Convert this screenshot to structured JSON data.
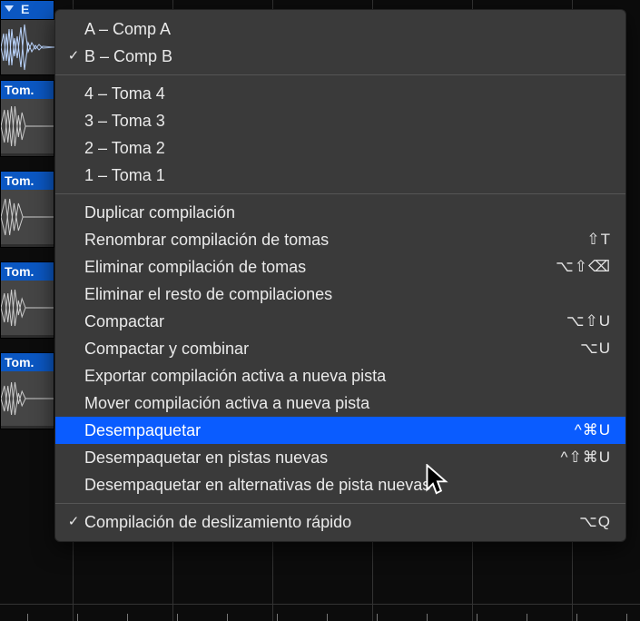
{
  "topbar_letter": "E",
  "takes": [
    {
      "label": "Tom."
    },
    {
      "label": "Tom."
    },
    {
      "label": "Tom."
    },
    {
      "label": "Tom."
    }
  ],
  "menu": {
    "section1": [
      {
        "checked": false,
        "label": "A – Comp A",
        "shortcut": ""
      },
      {
        "checked": true,
        "label": "B – Comp B",
        "shortcut": ""
      }
    ],
    "section2": [
      {
        "checked": false,
        "label": "4 – Toma 4",
        "shortcut": ""
      },
      {
        "checked": false,
        "label": "3 – Toma 3",
        "shortcut": ""
      },
      {
        "checked": false,
        "label": "2 – Toma 2",
        "shortcut": ""
      },
      {
        "checked": false,
        "label": "1 – Toma 1",
        "shortcut": ""
      }
    ],
    "section3": [
      {
        "checked": false,
        "label": "Duplicar compilación",
        "shortcut": "",
        "hl": false
      },
      {
        "checked": false,
        "label": "Renombrar compilación de tomas",
        "shortcut": "⇧T",
        "hl": false
      },
      {
        "checked": false,
        "label": "Eliminar compilación de tomas",
        "shortcut": "⌥⇧⌫",
        "hl": false
      },
      {
        "checked": false,
        "label": "Eliminar el resto de compilaciones",
        "shortcut": "",
        "hl": false
      },
      {
        "checked": false,
        "label": "Compactar",
        "shortcut": "⌥⇧U",
        "hl": false
      },
      {
        "checked": false,
        "label": "Compactar y combinar",
        "shortcut": "⌥U",
        "hl": false
      },
      {
        "checked": false,
        "label": "Exportar compilación activa a nueva pista",
        "shortcut": "",
        "hl": false
      },
      {
        "checked": false,
        "label": "Mover compilación activa a nueva pista",
        "shortcut": "",
        "hl": false
      },
      {
        "checked": false,
        "label": "Desempaquetar",
        "shortcut": "^⌘U",
        "hl": true
      },
      {
        "checked": false,
        "label": "Desempaquetar en pistas nuevas",
        "shortcut": "^⇧⌘U",
        "hl": false
      },
      {
        "checked": false,
        "label": "Desempaquetar en alternativas de pista nuevas",
        "shortcut": "",
        "hl": false
      }
    ],
    "section4": [
      {
        "checked": true,
        "label": "Compilación de deslizamiento rápido",
        "shortcut": "⌥Q"
      }
    ]
  },
  "checkmark_glyph": "✓"
}
